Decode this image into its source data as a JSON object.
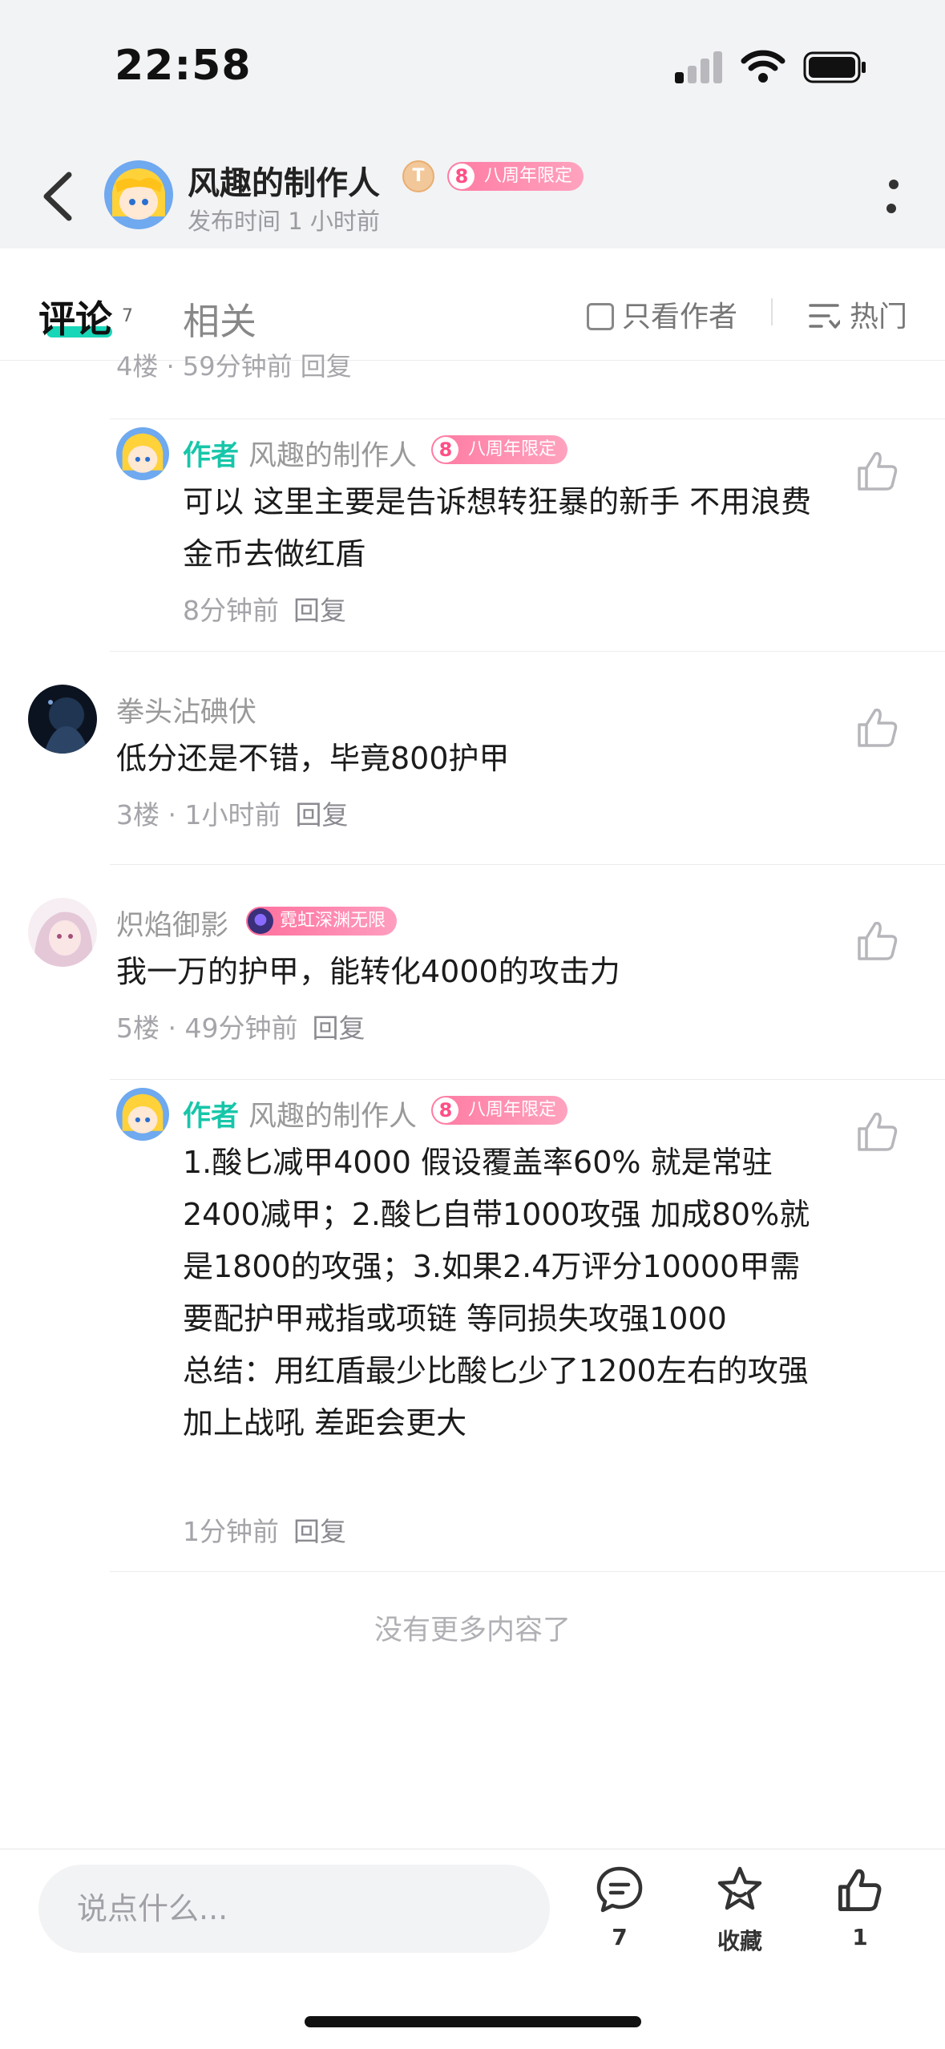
{
  "status_bar": {
    "time": "22:58"
  },
  "header": {
    "author_name": "风趣的制作人",
    "level_badge": "T",
    "anniversary_badge": "八周年限定",
    "publish_time": "发布时间 1 小时前"
  },
  "tabs": {
    "active": "评论",
    "active_count": "7",
    "inactive": "相关",
    "only_author": "只看作者",
    "sort": "热门"
  },
  "clipped_meta": "4楼 · 59分钟前  回复",
  "comments": [
    {
      "author_tag": "作者",
      "name": "风趣的制作人",
      "badge": "八周年限定",
      "text": "可以 这里主要是告诉想转狂暴的新手 不用浪费金币去做红盾",
      "meta": "8分钟前",
      "reply": "回复"
    },
    {
      "name": "拳头沾碘伏",
      "text": "低分还是不错，毕竟800护甲",
      "meta": "3楼 · 1小时前",
      "reply": "回复"
    },
    {
      "name": "炽焰御影",
      "badge": "霓虹深渊无限",
      "text": "我一万的护甲，能转化4000的攻击力",
      "meta": "5楼 · 49分钟前",
      "reply": "回复"
    },
    {
      "author_tag": "作者",
      "name": "风趣的制作人",
      "badge": "八周年限定",
      "text": "1.酸匕减甲4000 假设覆盖率60% 就是常驻2400减甲；2.酸匕自带1000攻强 加成80%就是1800的攻强；3.如果2.4万评分10000甲需要配护甲戒指或项链 等同损失攻强1000\n总结：用红盾最少比酸匕少了1200左右的攻强 加上战吼 差距会更大",
      "meta": "1分钟前",
      "reply": "回复"
    }
  ],
  "end_text": "没有更多内容了",
  "bottom_bar": {
    "input_placeholder": "说点什么...",
    "comment_count": "7",
    "favorite_label": "收藏",
    "like_count": "1"
  },
  "colors": {
    "accent": "#18d6b8",
    "badge_pink": "#ff7aa2"
  }
}
